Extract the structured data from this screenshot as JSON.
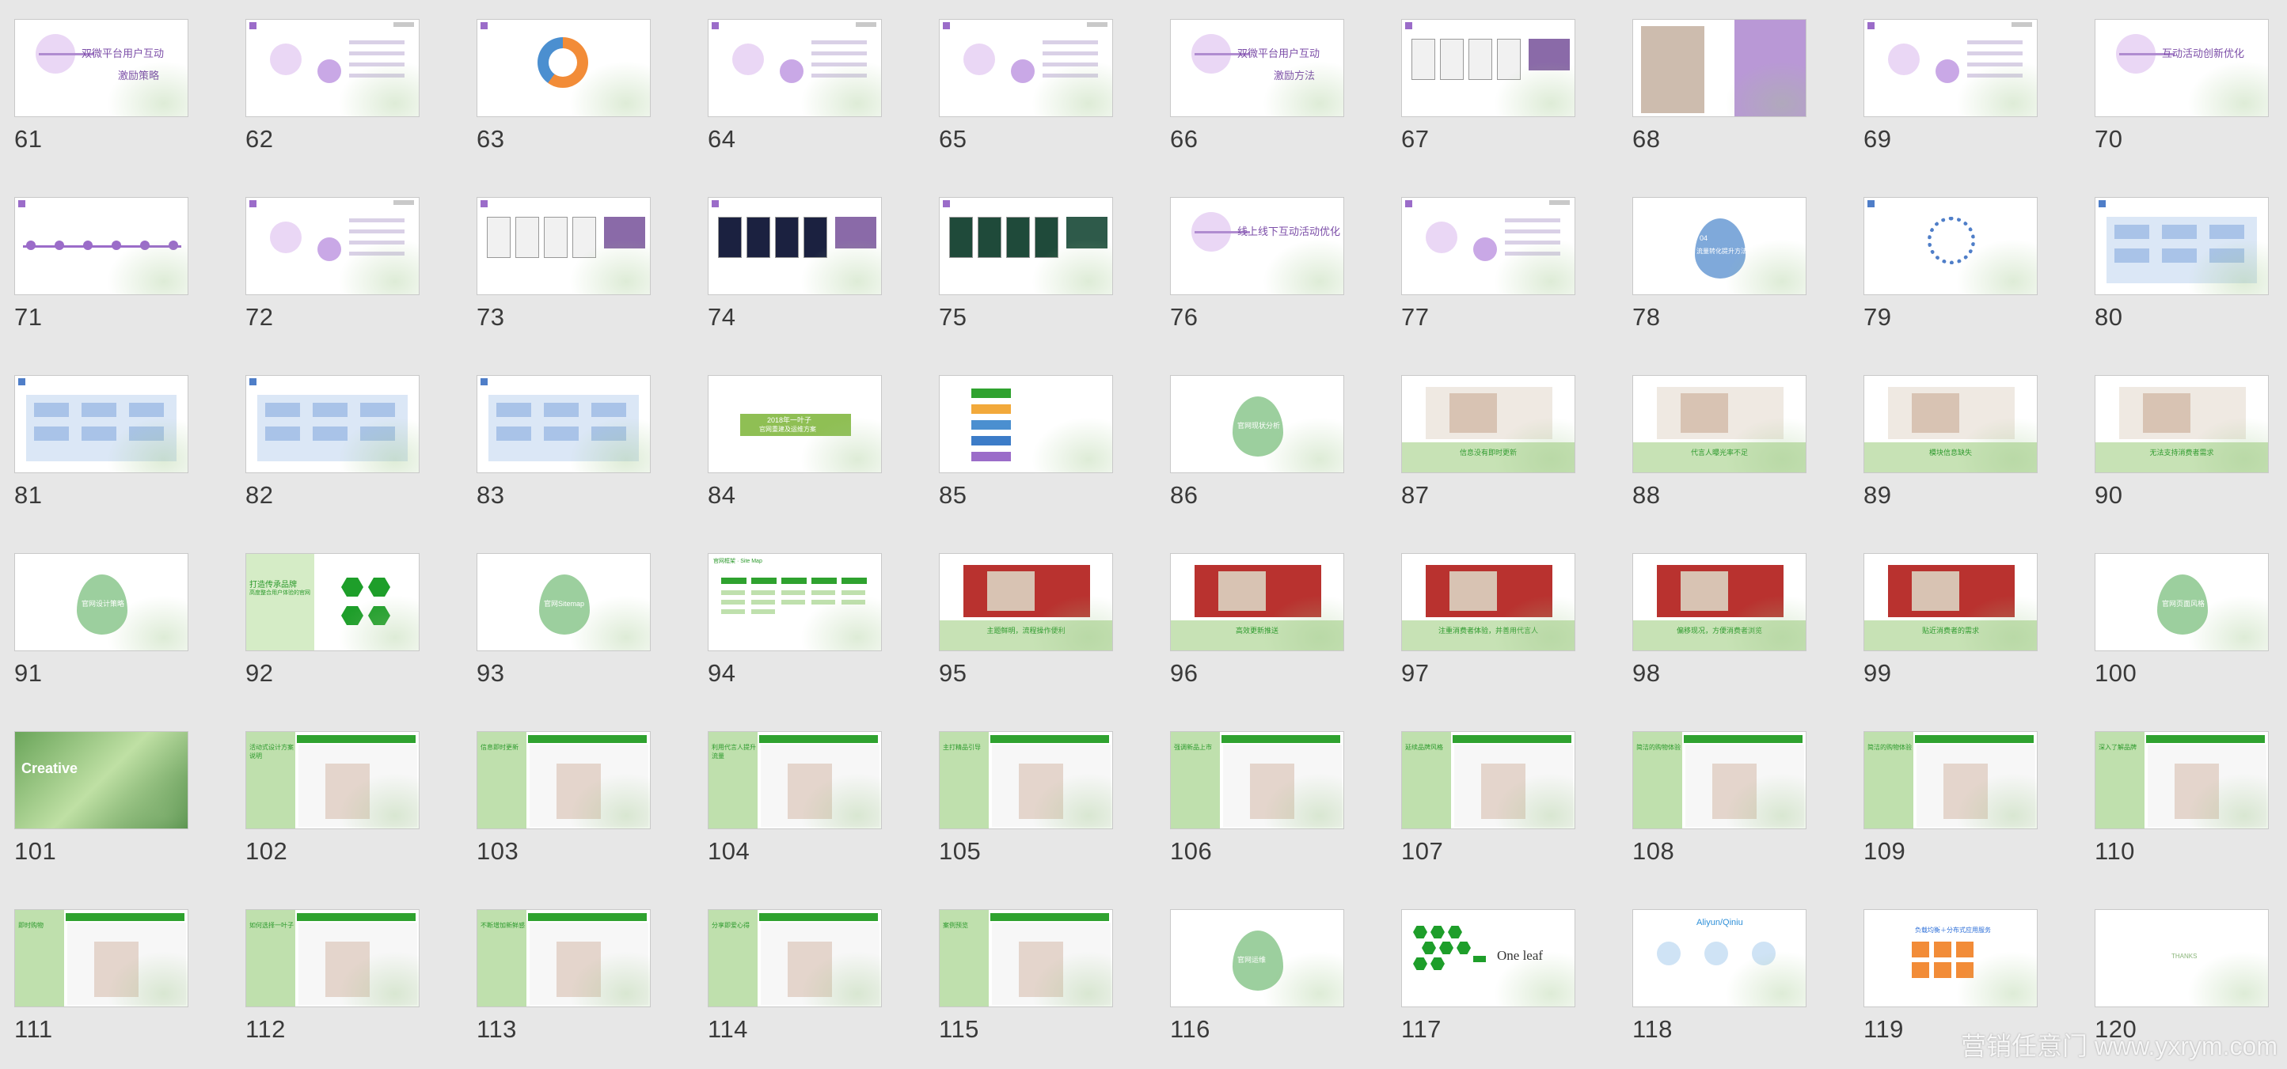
{
  "watermark": "营销任意门 www.yxrym.com",
  "thumbnails": [
    {
      "n": "61",
      "type": "section",
      "title": "双微平台用户互动",
      "subtitle": "激励策略"
    },
    {
      "n": "62",
      "type": "purple"
    },
    {
      "n": "63",
      "type": "donut"
    },
    {
      "n": "64",
      "type": "purple"
    },
    {
      "n": "65",
      "type": "purple"
    },
    {
      "n": "66",
      "type": "section",
      "title": "双微平台用户互动",
      "subtitle": "激励方法"
    },
    {
      "n": "67",
      "type": "phones"
    },
    {
      "n": "68",
      "type": "portrait"
    },
    {
      "n": "69",
      "type": "purple"
    },
    {
      "n": "70",
      "type": "section",
      "title": "互动活动创新优化",
      "subtitle": ""
    },
    {
      "n": "71",
      "type": "timeline"
    },
    {
      "n": "72",
      "type": "purple"
    },
    {
      "n": "73",
      "type": "phones"
    },
    {
      "n": "74",
      "type": "dark"
    },
    {
      "n": "75",
      "type": "darkgreen"
    },
    {
      "n": "76",
      "type": "section",
      "title": "线上线下互动活动优化",
      "subtitle": ""
    },
    {
      "n": "77",
      "type": "purple"
    },
    {
      "n": "78",
      "type": "leafblue",
      "title": "04",
      "subtitle": "流量转化提升方法"
    },
    {
      "n": "79",
      "type": "circle"
    },
    {
      "n": "80",
      "type": "blue"
    },
    {
      "n": "81",
      "type": "blue"
    },
    {
      "n": "82",
      "type": "blue"
    },
    {
      "n": "83",
      "type": "table"
    },
    {
      "n": "84",
      "type": "banner",
      "title": "2018年一叶子",
      "subtitle": "官网重建及运维方案"
    },
    {
      "n": "85",
      "type": "steps"
    },
    {
      "n": "86",
      "type": "leaf",
      "title": "官网现状分析"
    },
    {
      "n": "87",
      "type": "site",
      "caption": "信息没有即时更新"
    },
    {
      "n": "88",
      "type": "site",
      "caption": "代言人曝光率不足"
    },
    {
      "n": "89",
      "type": "site",
      "caption": "模块信息缺失"
    },
    {
      "n": "90",
      "type": "site",
      "caption": "无法支持消费者需求"
    },
    {
      "n": "91",
      "type": "leaf",
      "title": "官网设计策略"
    },
    {
      "n": "92",
      "type": "strategy",
      "title": "打造传承品牌",
      "subtitle": "高度整合用户体验的官网"
    },
    {
      "n": "93",
      "type": "leaf",
      "title": "官网Sitemap"
    },
    {
      "n": "94",
      "type": "sitemap",
      "title": "官网框架 · Site Map"
    },
    {
      "n": "95",
      "type": "reference",
      "caption": "主题鲜明，流程操作便利"
    },
    {
      "n": "96",
      "type": "reference",
      "caption": "高效更新推送"
    },
    {
      "n": "97",
      "type": "reference",
      "caption": "注重消费者体验，并善用代言人"
    },
    {
      "n": "98",
      "type": "reference",
      "caption": "偏移现况，方便消费者浏览"
    },
    {
      "n": "99",
      "type": "reference",
      "caption": "贴近消费者的需求"
    },
    {
      "n": "100",
      "type": "leaf",
      "title": "官网页面风格"
    },
    {
      "n": "101",
      "type": "creative",
      "title": "Creative"
    },
    {
      "n": "102",
      "type": "web",
      "title": "活动式设计方案说明"
    },
    {
      "n": "103",
      "type": "web",
      "title": "信息即时更新"
    },
    {
      "n": "104",
      "type": "web",
      "title": "利用代言人提升流量"
    },
    {
      "n": "105",
      "type": "web",
      "title": "主打精品引导"
    },
    {
      "n": "106",
      "type": "web",
      "title": "强调新品上市"
    },
    {
      "n": "107",
      "type": "web",
      "title": "延续品牌风格"
    },
    {
      "n": "108",
      "type": "web",
      "title": "简洁的购物体验"
    },
    {
      "n": "109",
      "type": "web",
      "title": "简洁的购物体验"
    },
    {
      "n": "110",
      "type": "web",
      "title": "深入了解品牌"
    },
    {
      "n": "111",
      "type": "web",
      "title": "即时购物"
    },
    {
      "n": "112",
      "type": "web",
      "title": "如何选择一叶子"
    },
    {
      "n": "113",
      "type": "web",
      "title": "不断增加新鲜感"
    },
    {
      "n": "114",
      "type": "web",
      "title": "分享即爱心得"
    },
    {
      "n": "115",
      "type": "web",
      "title": "案例预览"
    },
    {
      "n": "116",
      "type": "leaf",
      "title": "官网运维"
    },
    {
      "n": "117",
      "type": "hex",
      "title": "One leaf"
    },
    {
      "n": "118",
      "type": "aliyun",
      "title": "Aliyun/Qiniu"
    },
    {
      "n": "119",
      "type": "server",
      "title": "负载均衡＋分布式应用服务"
    },
    {
      "n": "120",
      "type": "thanks",
      "title": "THANKS"
    }
  ]
}
